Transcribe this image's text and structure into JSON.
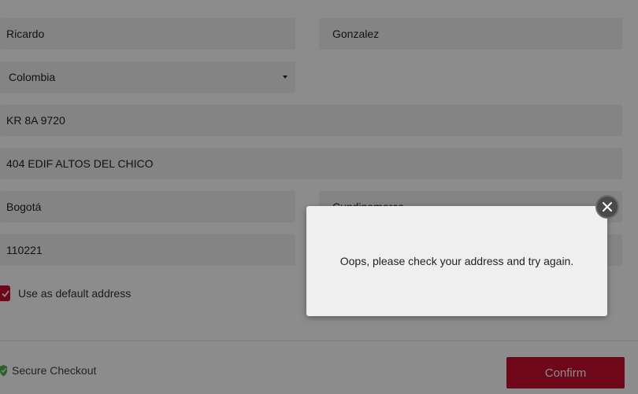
{
  "form": {
    "first_name": "Ricardo",
    "last_name": "Gonzalez",
    "country": "Colombia",
    "address_line1": "KR 8A 9720",
    "address_line2": "404 EDIF ALTOS DEL CHICO",
    "city": "Bogotá",
    "state": "Cundinamarca",
    "postal_code": "110221",
    "default_address_label": "Use as default address",
    "default_address_checked": true
  },
  "footer": {
    "secure_label": "Secure Checkout",
    "confirm_label": "Confirm"
  },
  "modal": {
    "message": "Oops, please check your address and try again."
  },
  "colors": {
    "accent": "#c8102e",
    "secure_icon": "#4caf50"
  },
  "icons": {
    "checkbox": "check-icon",
    "secure": "shield-check-icon",
    "close": "close-icon",
    "dropdown": "caret-down-icon"
  }
}
